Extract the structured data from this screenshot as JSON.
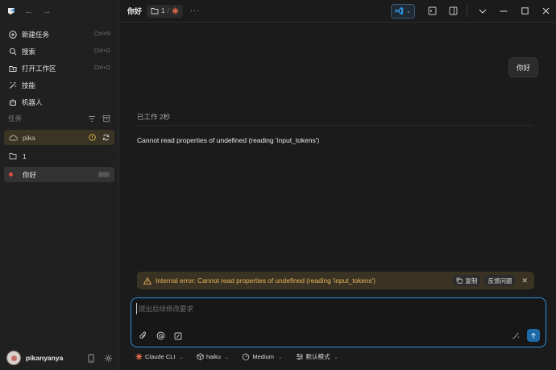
{
  "colors": {
    "accent": "#2f8fd8",
    "warning": "#e6b35c",
    "danger": "#e04a3f",
    "task_active": "#3a3424"
  },
  "sidebar": {
    "menu": [
      {
        "label": "新建任务",
        "shortcut": "Ctrl+N",
        "icon": "plus-circle-icon"
      },
      {
        "label": "搜索",
        "shortcut": "Ctrl+G",
        "icon": "search-icon"
      },
      {
        "label": "打开工作区",
        "shortcut": "Ctrl+O",
        "icon": "folder-open-icon"
      },
      {
        "label": "技能",
        "shortcut": "",
        "icon": "wand-icon"
      },
      {
        "label": "机器人",
        "shortcut": "",
        "icon": "robot-icon"
      }
    ],
    "tasks_header": "任务",
    "tasks": [
      {
        "label": "pika",
        "meta": ""
      },
      {
        "label": "1",
        "meta": ""
      },
      {
        "label": "你好",
        "meta": "刚刚"
      }
    ],
    "username": "pikanyanya"
  },
  "topbar": {
    "title": "你好",
    "crumb_folder": "1",
    "crumb_sep": "/",
    "more": "···"
  },
  "chat": {
    "user_message": "你好",
    "worked": "已工作 2秒",
    "error_message": "Cannot read properties of undefined (reading 'input_tokens')",
    "banner": {
      "text": "Internal error: Cannot read properties of undefined (reading 'input_tokens')",
      "copy_label": "复制",
      "feedback_label": "反馈问题"
    }
  },
  "composer": {
    "placeholder": "提出后续修改要求"
  },
  "bottombar": {
    "agent": "Claude CLI",
    "model": "haiku",
    "effort": "Medium",
    "mode": "默认模式"
  }
}
